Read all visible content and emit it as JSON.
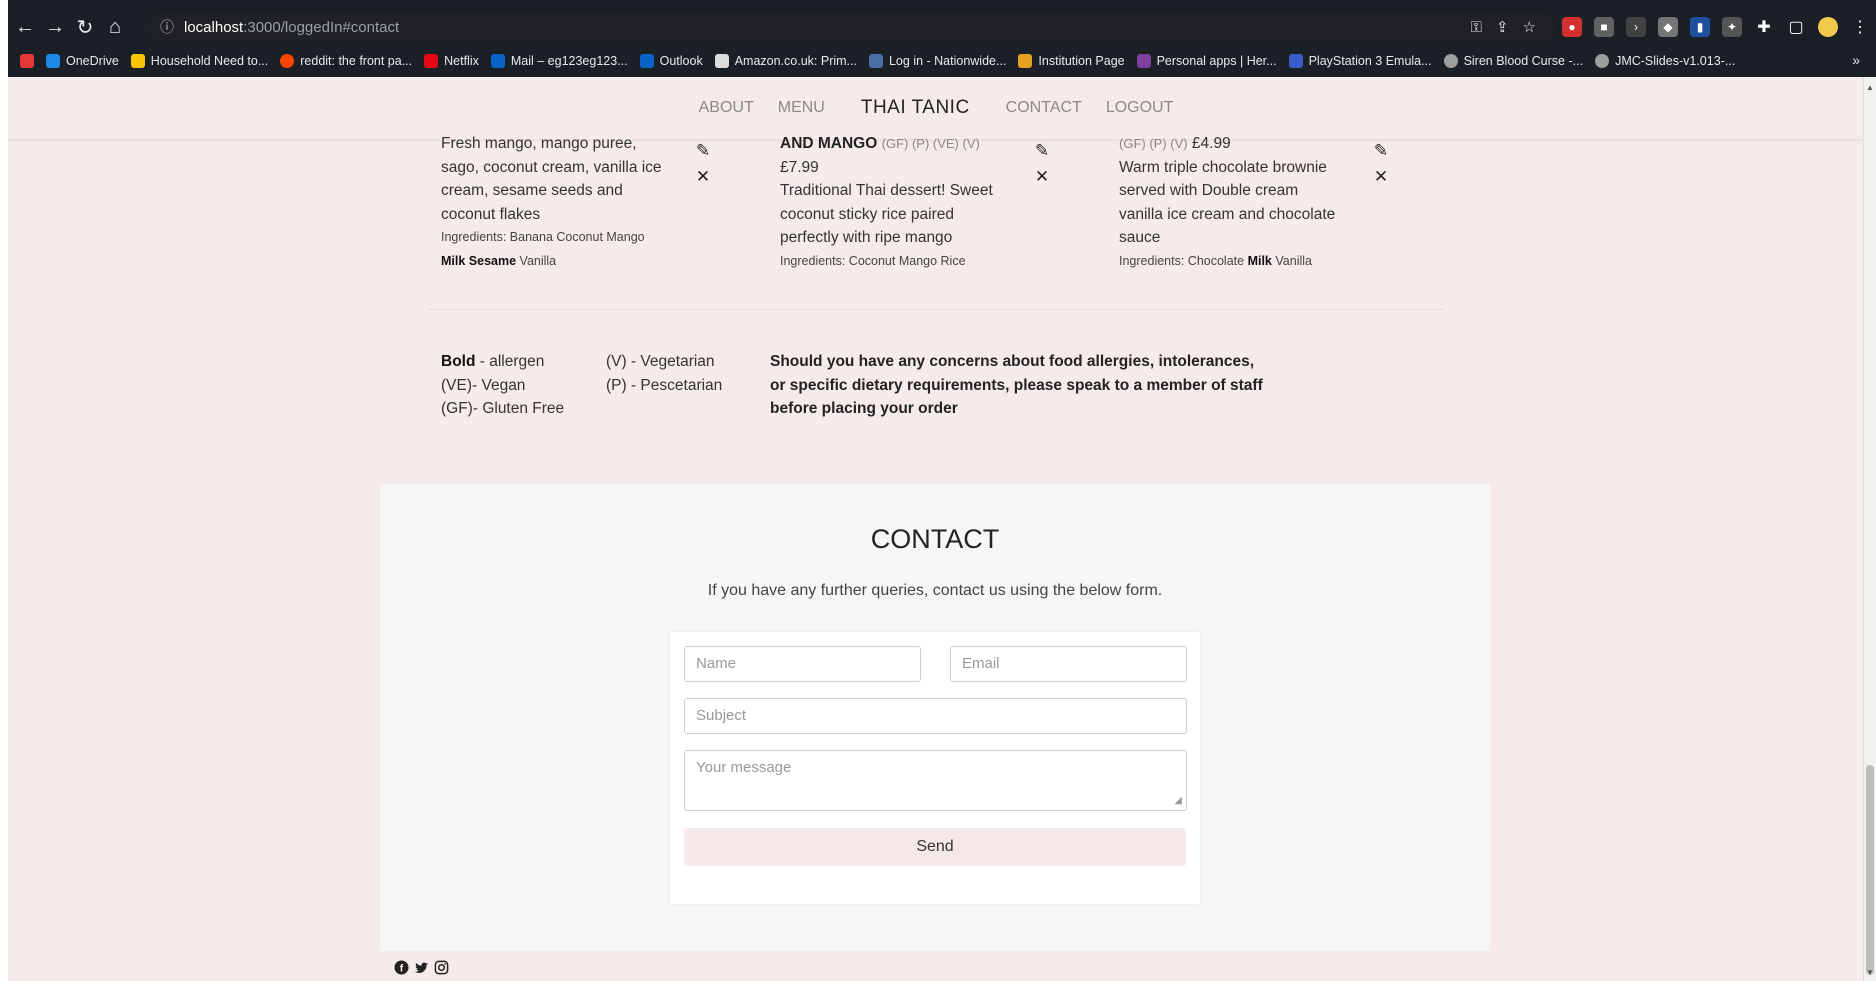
{
  "browser": {
    "url_host": "localhost",
    "url_path": ":3000/loggedIn#contact",
    "bookmarks": [
      {
        "label": "OneDrive",
        "color": "#1e88e5"
      },
      {
        "label": "Household Need to...",
        "color": "#f9c400"
      },
      {
        "label": "reddit: the front pa...",
        "color": "#ff4500"
      },
      {
        "label": "Netflix",
        "color": "#e50914"
      },
      {
        "label": "Mail – eg123eg123...",
        "color": "#0a64c8"
      },
      {
        "label": "Outlook",
        "color": "#0a64c8"
      },
      {
        "label": "Amazon.co.uk: Prim...",
        "color": "#dddddd"
      },
      {
        "label": "Log in - Nationwide...",
        "color": "#4a6fa5"
      },
      {
        "label": "Institution Page",
        "color": "#e8a020"
      },
      {
        "label": "Personal apps | Her...",
        "color": "#7b3fa0"
      },
      {
        "label": "PlayStation 3 Emula...",
        "color": "#3a5cc8"
      },
      {
        "label": "Siren Blood Curse -...",
        "color": "#9e9e9e"
      },
      {
        "label": "JMC-Slides-v1.013-...",
        "color": "#9e9e9e"
      }
    ],
    "more": "»"
  },
  "nav": {
    "about": "ABOUT",
    "menu": "MENU",
    "brand": "THAI TANIC",
    "contact": "CONTACT",
    "logout": "LOGOUT"
  },
  "dishes": [
    {
      "line1": "Fresh mango, mango puree,",
      "line2": "sago, coconut cream, vanilla ice",
      "line3": "cream, sesame seeds and",
      "line4": "coconut flakes",
      "ing_label": "Ingredients: Banana Coconut Mango",
      "ing_bold": "Milk Sesame",
      "ing_rest": "Vanilla"
    },
    {
      "name_tail": "AND MANGO",
      "tags": "(GF) (P) (VE) (V)",
      "price": "£7.99",
      "line1": "Traditional Thai dessert! Sweet",
      "line2": "coconut sticky rice paired",
      "line3": "perfectly with ripe mango",
      "ing_label": "Ingredients: Coconut Mango Rice"
    },
    {
      "tags": "(GF) (P) (V)",
      "price": "£4.99",
      "line1": "Warm triple chocolate brownie",
      "line2": "served with Double cream",
      "line3": "vanilla ice cream and chocolate",
      "line4": "sauce",
      "ing_label": "Ingredients: Chocolate",
      "ing_bold": "Milk",
      "ing_rest": "Vanilla"
    }
  ],
  "icons": {
    "edit": "✎",
    "delete": "✕"
  },
  "legend": {
    "bold_label": "Bold",
    "bold_desc": " - allergen",
    "vegan": "(VE)- Vegan",
    "gluten": "(GF)- Gluten Free",
    "vegetarian": "(V) - Vegetarian",
    "pescetarian": "(P) - Pescetarian",
    "notice": "Should you have any concerns about food allergies, intolerances, or specific dietary requirements, please speak to a member of staff before placing your order"
  },
  "contact": {
    "title": "CONTACT",
    "subtitle": "If you have any further queries, contact us using the below form.",
    "name_placeholder": "Name",
    "email_placeholder": "Email",
    "subject_placeholder": "Subject",
    "message_placeholder": "Your message",
    "send_label": "Send"
  },
  "social": [
    "facebook-icon",
    "twitter-icon",
    "instagram-icon"
  ]
}
